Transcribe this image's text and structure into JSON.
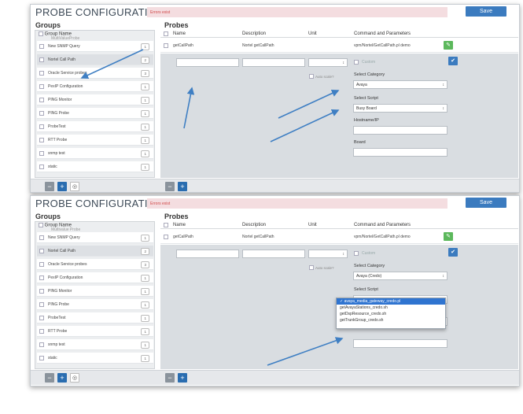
{
  "app_title": "PROBE CONFIGURATION",
  "error_text": "Errors exist",
  "save_label": "Save",
  "groups_title": "Groups",
  "probes_title": "Probes",
  "groups_header": "Group Name",
  "groups_ghost_top": "MultiValueProbe",
  "groups_ghost_bottom": "Multivalue Probe",
  "groups": [
    {
      "name": "New SNMP Query",
      "count": "1"
    },
    {
      "name": "Nortel Call Path",
      "count": "2"
    },
    {
      "name": "Oracle Service probes",
      "count": "3"
    },
    {
      "name": "PexIP Configuration",
      "count": "1"
    },
    {
      "name": "PING Monitor",
      "count": "1"
    },
    {
      "name": "PING Probe",
      "count": "1"
    },
    {
      "name": "ProbeTest",
      "count": "1"
    },
    {
      "name": "RTT Probe",
      "count": "1"
    },
    {
      "name": "snmp test",
      "count": "1"
    },
    {
      "name": "static",
      "count": "1"
    }
  ],
  "probes_headers": {
    "name": "Name",
    "description": "Description",
    "unit": "Unit",
    "command": "Command and Parameters"
  },
  "probe_row": {
    "name": "getCallPath",
    "description": "Nortel getCallPath",
    "command": "vpm/Nortel/GetCallPath.pl demo"
  },
  "labels": {
    "custom": "Custom",
    "auto_scale": "Auto scale?",
    "select_category": "Select Category",
    "select_script": "Select Script",
    "hostname": "Hostname/IP",
    "board": "Board"
  },
  "top_panel": {
    "category": "Avaya",
    "script": "Busy Board"
  },
  "bottom_panel": {
    "category": "Avaya (Credo)"
  },
  "dropdown_options": [
    "✓ avaya_media_gateway_credo.pl",
    "getAvayaStations_credo.sh",
    "getDspResource_credo.sh",
    "getTrunkGroup_credo.sh"
  ],
  "icons": {
    "minus": "−",
    "plus": "+",
    "link": "◎",
    "pencil": "✎",
    "check": "✔",
    "chevron": "↕"
  },
  "colors": {
    "accent": "#3b7bbf",
    "error_bg": "#f4dde0",
    "edit_green": "#5cb85c"
  }
}
